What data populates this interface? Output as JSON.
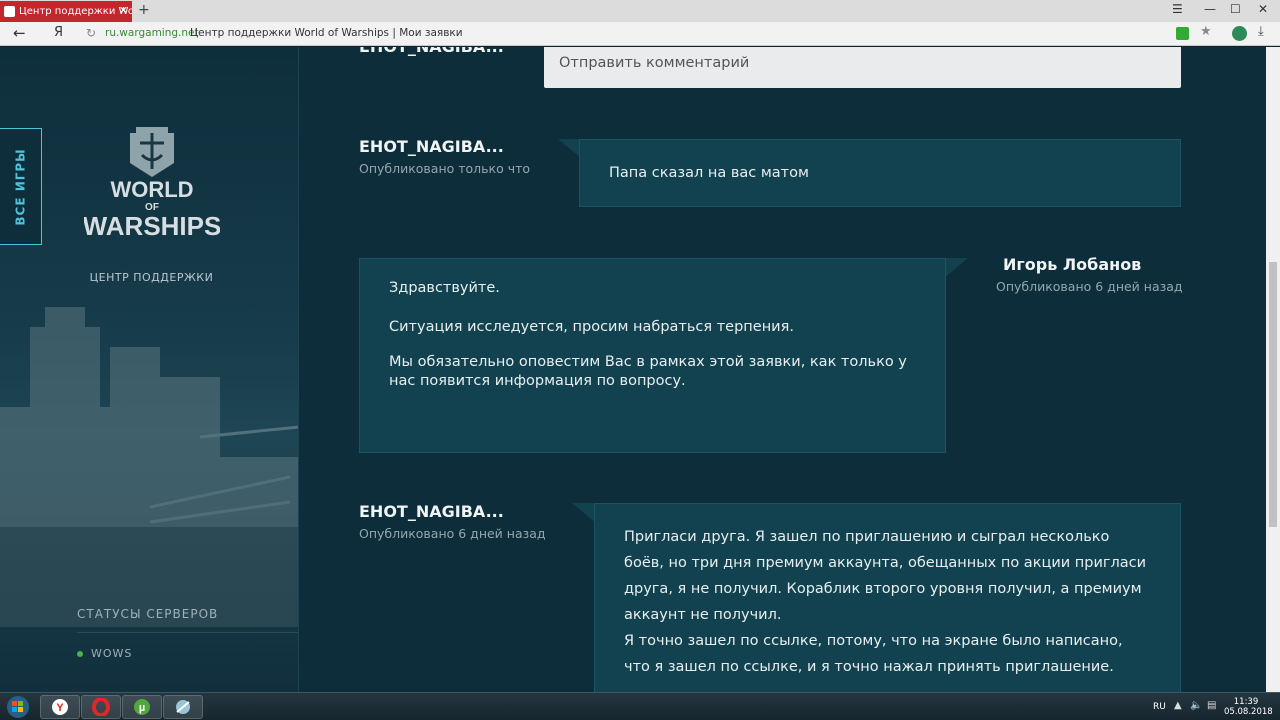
{
  "browser": {
    "tab_title": "Центр поддержки World of Warships",
    "new_tab": "+",
    "lang_button": "Я",
    "domain": "ru.wargaming.net",
    "page_title": "Центр поддержки World of Warships | Мои заявки"
  },
  "sidebar": {
    "all_games": "ВСЕ ИГРЫ",
    "logo": {
      "line1": "WORLD",
      "line2": "OF",
      "line3": "WARSHIPS"
    },
    "support_center": "ЦЕНТР ПОДДЕРЖКИ",
    "server_status_title": "СТАТУСЫ СЕРВЕРОВ",
    "servers": [
      {
        "name": "WOWS",
        "status_color": "#4caf50"
      }
    ]
  },
  "thread": {
    "comment_placeholder": "Отправить комментарий",
    "messages": [
      {
        "author": "EHOT_NAGIBA...",
        "posted": "",
        "text": ""
      },
      {
        "author": "EHOT_NAGIBA...",
        "posted": "Опубликовано только что",
        "text": "Папа сказал на вас матом"
      },
      {
        "author": "Игорь Лобанов",
        "posted": "Опубликовано 6 дней назад",
        "paragraphs": [
          "Здравствуйте.",
          "Ситуация исследуется, просим набраться терпения.",
          "Мы обязательно оповестим Вас в рамках этой заявки, как только у нас появится информация по вопросу."
        ]
      },
      {
        "author": "EHOT_NAGIBA...",
        "posted": "Опубликовано 6 дней назад",
        "paragraphs": [
          "Пригласи друга. Я зашел по приглашению и сыграл несколько боёв, но три дня премиум аккаунта, обещанных по акции пригласи друга, я не получил. Кораблик второго уровня получил, а премиум аккаунт не получил.",
          "Я точно зашел по ссылке, потому, что на экране было написано, что я зашел по ссылке, и я точно нажал принять приглашение."
        ]
      }
    ]
  },
  "taskbar": {
    "lang": "RU",
    "time": "11:39",
    "date": "05.08.2018"
  },
  "colors": {
    "accent": "#4fc3d9",
    "bubble": "#12424f",
    "page_bg": "#0d2d3a",
    "tab_red": "#c1272d"
  }
}
